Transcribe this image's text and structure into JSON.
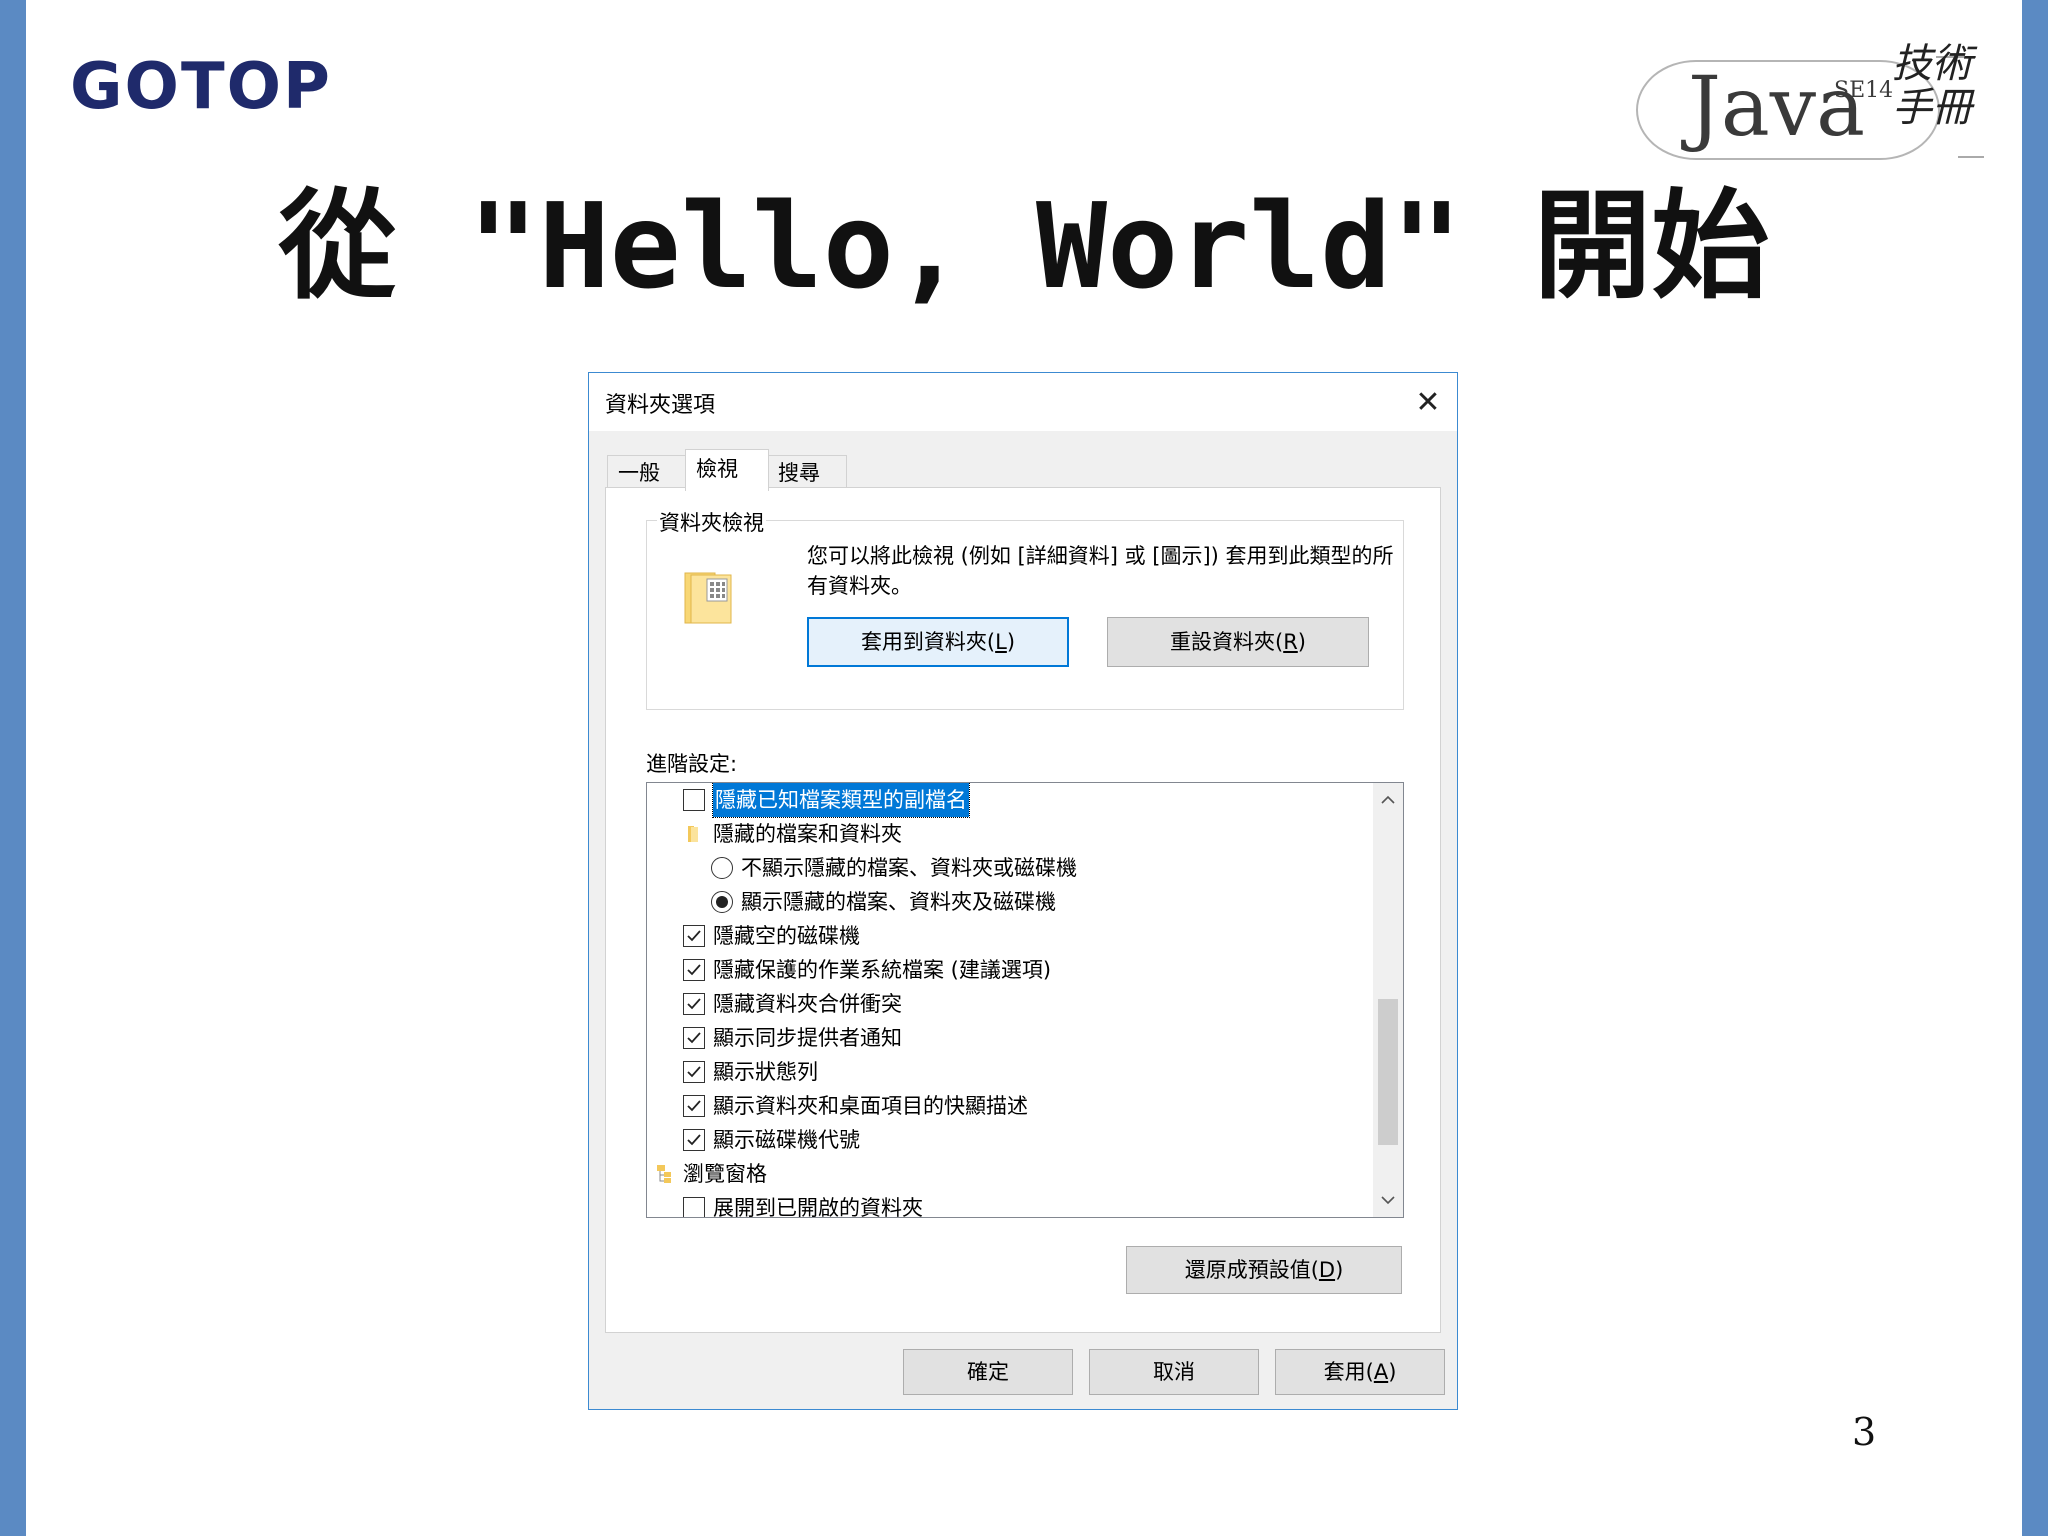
{
  "slide": {
    "brand": "GOTOP",
    "java_logo": {
      "word": "Java",
      "edition": "SE14",
      "handwritten": "技術手冊"
    },
    "title": "從 \"Hello, World\" 開始",
    "page_number": "3"
  },
  "dialog": {
    "title": "資料夾選項",
    "close_glyph": "✕",
    "tabs": [
      {
        "label": "一般",
        "active": false
      },
      {
        "label": "檢視",
        "active": true
      },
      {
        "label": "搜尋",
        "active": false
      }
    ],
    "folder_views": {
      "legend": "資料夾檢視",
      "description": "您可以將此檢視 (例如 [詳細資料] 或 [圖示]) 套用到此類型的所有資料夾。",
      "apply_button": {
        "text": "套用到資料夾(",
        "key": "L",
        "end": ")"
      },
      "reset_button": {
        "text": "重設資料夾(",
        "key": "R",
        "end": ")"
      }
    },
    "advanced_label": "進階設定:",
    "advanced_items": [
      {
        "type": "checkbox",
        "label": "隱藏已知檔案類型的副檔名",
        "checked": false,
        "selected": true,
        "indent": 1
      },
      {
        "type": "folder",
        "label": "隱藏的檔案和資料夾",
        "indent": 1
      },
      {
        "type": "radio",
        "label": "不顯示隱藏的檔案、資料夾或磁碟機",
        "checked": false,
        "indent": 2
      },
      {
        "type": "radio",
        "label": "顯示隱藏的檔案、資料夾及磁碟機",
        "checked": true,
        "indent": 2
      },
      {
        "type": "checkbox",
        "label": "隱藏空的磁碟機",
        "checked": true,
        "indent": 1
      },
      {
        "type": "checkbox",
        "label": "隱藏保護的作業系統檔案 (建議選項)",
        "checked": true,
        "indent": 1
      },
      {
        "type": "checkbox",
        "label": "隱藏資料夾合併衝突",
        "checked": true,
        "indent": 1
      },
      {
        "type": "checkbox",
        "label": "顯示同步提供者通知",
        "checked": true,
        "indent": 1
      },
      {
        "type": "checkbox",
        "label": "顯示狀態列",
        "checked": true,
        "indent": 1
      },
      {
        "type": "checkbox",
        "label": "顯示資料夾和桌面項目的快顯描述",
        "checked": true,
        "indent": 1
      },
      {
        "type": "checkbox",
        "label": "顯示磁碟機代號",
        "checked": true,
        "indent": 1
      },
      {
        "type": "category",
        "label": "瀏覽窗格",
        "indent": 0
      },
      {
        "type": "checkbox",
        "label": "展開到已開啟的資料夾",
        "checked": false,
        "indent": 1
      }
    ],
    "restore_button": {
      "text": "還原成預設值(",
      "key": "D",
      "end": ")"
    },
    "footer": {
      "ok": "確定",
      "cancel": "取消",
      "apply": {
        "text": "套用(",
        "key": "A",
        "end": ")"
      }
    },
    "colors": {
      "accent": "#0078d7",
      "border": "#3c8ad1",
      "slide_bar": "#5b8ac3",
      "brand": "#1f2a6b"
    }
  }
}
